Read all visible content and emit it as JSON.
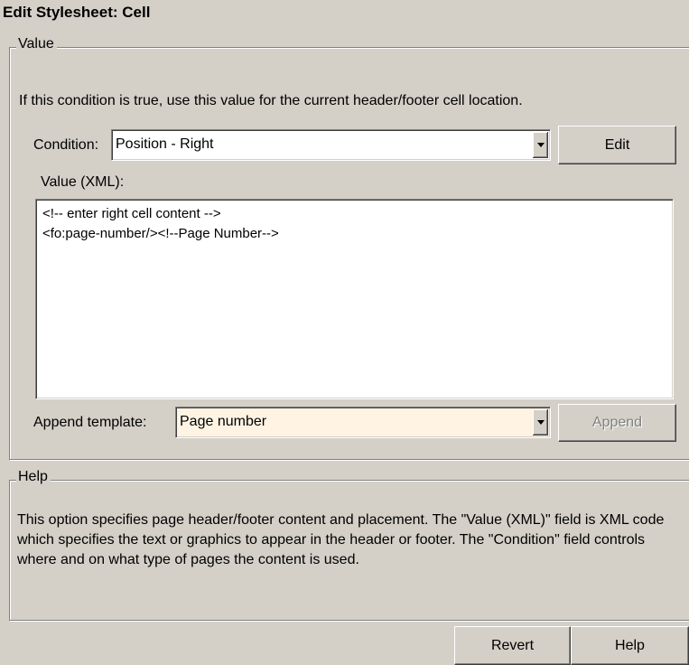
{
  "window": {
    "title": "Edit Stylesheet: Cell"
  },
  "value_group": {
    "legend": "Value",
    "description": "If this condition is true, use this value for the current header/footer cell location.",
    "condition_label": "Condition:",
    "condition_selected": "Position - Right",
    "edit_button": "Edit",
    "value_label": "Value (XML):",
    "xml_lines": [
      "<!-- enter right cell content -->",
      "<fo:page-number/><!--Page Number-->"
    ],
    "append_label": "Append template:",
    "append_selected": "Page number",
    "append_button": "Append"
  },
  "help_group": {
    "legend": "Help",
    "text": "This option specifies page header/footer content and placement.  The \"Value (XML)\" field is XML code which specifies the text or graphics to appear in the header or footer.  The \"Condition\" field controls where and on what type of pages the content is used."
  },
  "footer": {
    "revert_button": "Revert",
    "help_button": "Help"
  },
  "colors": {
    "dialog_bg": "#d4d0c8",
    "field_bg": "#ffffff",
    "append_combo_bg": "#fff4e4",
    "disabled_text": "#808080"
  }
}
